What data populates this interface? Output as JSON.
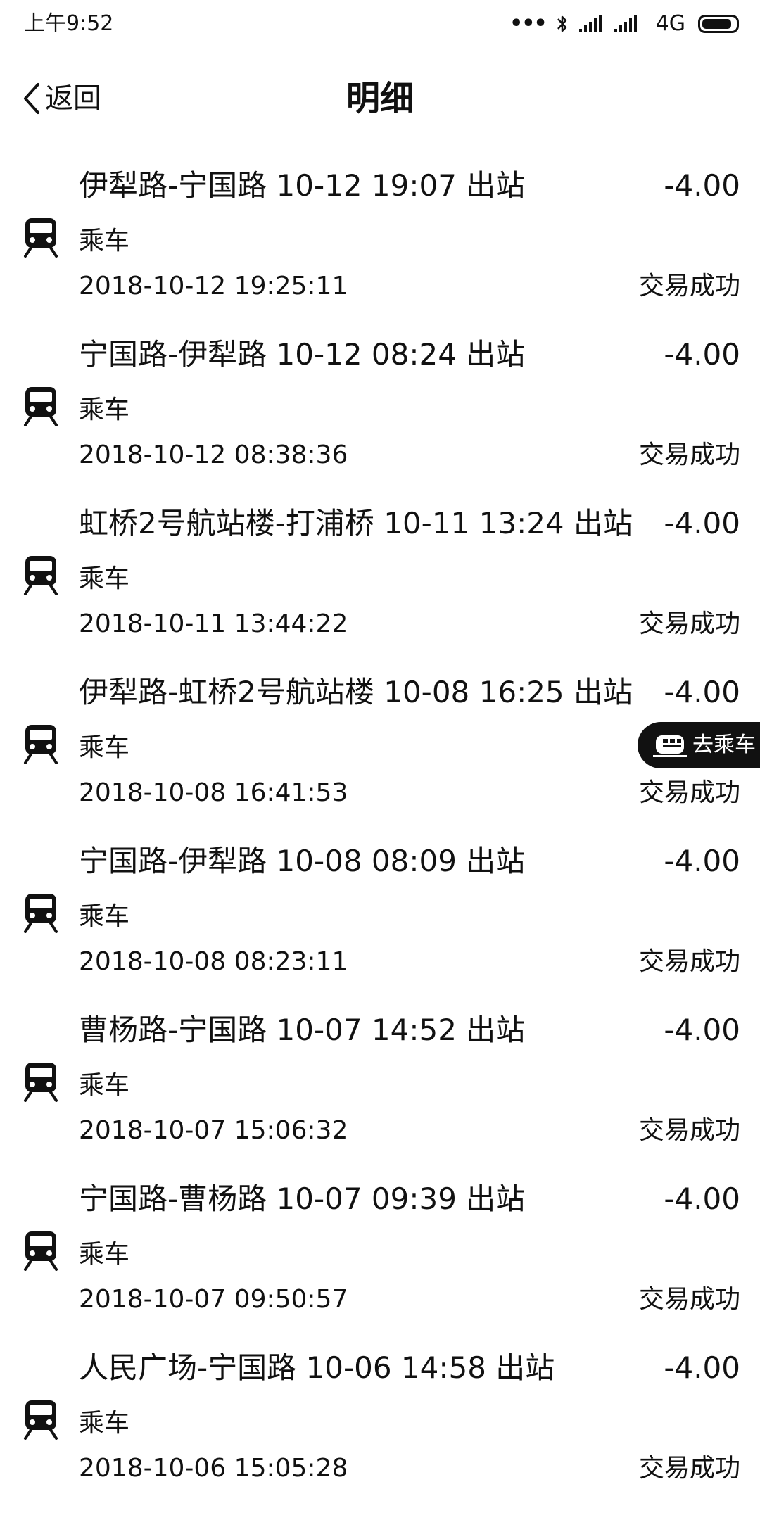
{
  "status_bar": {
    "time": "上午9:52",
    "network": "4G",
    "battery_level": 0.9
  },
  "header": {
    "back_label": "返回",
    "title": "明细"
  },
  "records": [
    {
      "route": "伊犁路-宁国路 10-12 19:07 出站",
      "amount": "-4.00",
      "type": "乘车",
      "time": "2018-10-12 19:25:11",
      "status": "交易成功"
    },
    {
      "route": "宁国路-伊犁路 10-12 08:24 出站",
      "amount": "-4.00",
      "type": "乘车",
      "time": "2018-10-12 08:38:36",
      "status": "交易成功"
    },
    {
      "route": "虹桥2号航站楼-打浦桥 10-11 13:24 出站",
      "amount": "-4.00",
      "type": "乘车",
      "time": "2018-10-11 13:44:22",
      "status": "交易成功"
    },
    {
      "route": "伊犁路-虹桥2号航站楼 10-08 16:25 出站",
      "amount": "-4.00",
      "type": "乘车",
      "time": "2018-10-08 16:41:53",
      "status": "交易成功"
    },
    {
      "route": "宁国路-伊犁路 10-08 08:09 出站",
      "amount": "-4.00",
      "type": "乘车",
      "time": "2018-10-08 08:23:11",
      "status": "交易成功"
    },
    {
      "route": "曹杨路-宁国路 10-07 14:52 出站",
      "amount": "-4.00",
      "type": "乘车",
      "time": "2018-10-07 15:06:32",
      "status": "交易成功"
    },
    {
      "route": "宁国路-曹杨路 10-07 09:39 出站",
      "amount": "-4.00",
      "type": "乘车",
      "time": "2018-10-07 09:50:57",
      "status": "交易成功"
    },
    {
      "route": "人民广场-宁国路 10-06 14:58 出站",
      "amount": "-4.00",
      "type": "乘车",
      "time": "2018-10-06 15:05:28",
      "status": "交易成功"
    }
  ],
  "floating_button": {
    "label": "去乘车",
    "icon": "train-icon"
  },
  "icons": {
    "record": "metro-train-icon",
    "back": "chevron-left-icon"
  },
  "colors": {
    "text": "#111111",
    "background": "#ffffff",
    "pill_background": "#111111",
    "pill_text": "#ffffff"
  }
}
